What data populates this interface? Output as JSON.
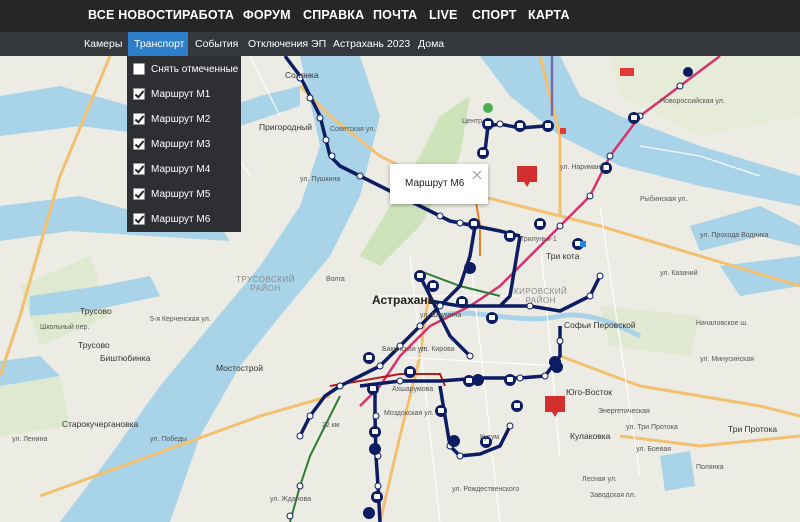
{
  "top_nav": [
    "ВСЕ НОВОСТИ",
    "РАБОТА",
    "ФОРУМ",
    "СПРАВКА",
    "ПОЧТА",
    "LIVE",
    "СПОРТ",
    "КАРТА"
  ],
  "sub_nav": [
    "Камеры",
    "Транспорт",
    "События",
    "Отключения ЭП",
    "Астрахань 2023",
    "Дома"
  ],
  "sub_nav_active": "Транспорт",
  "dropdown": {
    "uncheck_all": "Снять отмеченные",
    "routes": [
      {
        "label": "Маршрут М1",
        "checked": true
      },
      {
        "label": "Маршрут М2",
        "checked": true
      },
      {
        "label": "Маршрут М3",
        "checked": true
      },
      {
        "label": "Маршрут М4",
        "checked": true
      },
      {
        "label": "Маршрут М5",
        "checked": true
      },
      {
        "label": "Маршрут М6",
        "checked": true
      }
    ]
  },
  "popup": {
    "text": "Маршрут М6"
  },
  "map": {
    "city": "Астрахань",
    "districts": [
      "ТРУСОВСКИЙ\nРАЙОН",
      "КИРОВСКИЙ\nРАЙОН"
    ],
    "places": [
      "Солянка",
      "Пригородный",
      "Трусово",
      "Трусово",
      "Биштюбинка",
      "Мостострой",
      "Старокучергановка",
      "Центр",
      "Трилунья-1",
      "Три кота",
      "Софьи Перовской",
      "Юго-Восток",
      "Кулаковка",
      "Кутум",
      "Три Протока",
      "Полянка",
      "Началовское ш.",
      "Школьный пер.",
      "5-я Керченская ул.",
      "ул. Ленина",
      "ул. Победы",
      "ул. Шаумяна",
      "ул. Кирова",
      "Ахшарумова",
      "Моздокская ул.",
      "Бакинская ул.",
      "Советская ул.",
      "ул. Пушкина",
      "ул. Боевая",
      "Новороссийская ул.",
      "ул. Рождественского",
      "Лесная ул.",
      "Энергетическая",
      "ул. Три Протока",
      "ул. Жданова",
      "22 км",
      "Волга",
      "Заводская пл.",
      "ул. Минусинская",
      "ул. Наримана",
      "Рыбинская ул.",
      "ул. Прохода Водника",
      "ул. Казачий"
    ],
    "colors": {
      "route_navy": "#0d1d63",
      "route_pink": "#d6336c",
      "route_red": "#b71c1c",
      "route_green": "#2e7d32",
      "route_purple": "#7a6aa8",
      "water": "#a8d3e8",
      "land": "#ecebe4",
      "park": "#cfe3bb",
      "road": "#f3c070"
    }
  }
}
